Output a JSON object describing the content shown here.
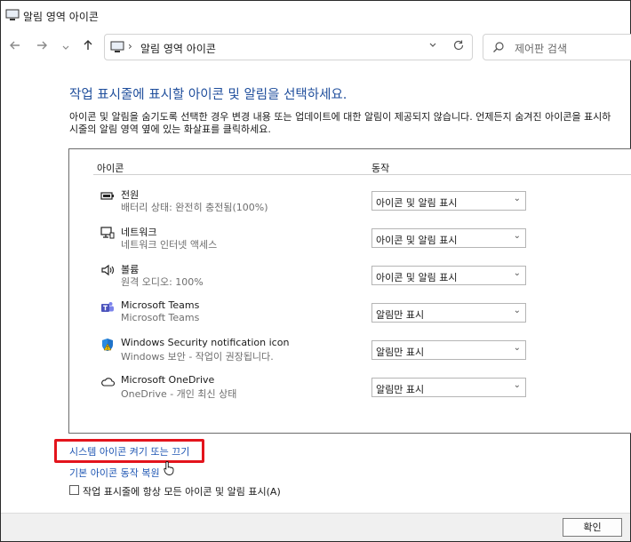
{
  "window": {
    "title": "알림 영역 아이콘"
  },
  "nav": {
    "back_icon": "arrow-left-icon",
    "forward_icon": "arrow-right-icon",
    "recent_icon": "chevron-down-icon",
    "up_icon": "arrow-up-icon",
    "address_sep": "›",
    "address_text": "알림 영역 아이콘",
    "search_placeholder": "제어판 검색"
  },
  "content": {
    "heading": "작업 표시줄에 표시할 아이콘 및 알림을 선택하세요.",
    "description_line1": "아이콘 및 알림을 숨기도록 선택한 경우 변경 내용 또는 업데이트에 대한 알림이 제공되지 않습니다. 언제든지 숨겨진 아이콘을 표시하",
    "description_line2": "시줄의 알림 영역 옆에 있는 화살표를 클릭하세요.",
    "col_icon": "아이콘",
    "col_action": "동작",
    "rows": [
      {
        "icon": "battery-icon",
        "name": "전원",
        "sub": "배터리 상태: 완전히 충전됨(100%)",
        "action": "아이콘 및 알림 표시"
      },
      {
        "icon": "network-icon",
        "name": "네트워크",
        "sub": "네트워크 인터넷 액세스",
        "action": "아이콘 및 알림 표시"
      },
      {
        "icon": "volume-icon",
        "name": "볼륨",
        "sub": "원격 오디오: 100%",
        "action": "아이콘 및 알림 표시"
      },
      {
        "icon": "teams-icon",
        "name": "Microsoft Teams",
        "sub": "Microsoft Teams",
        "action": "알림만 표시"
      },
      {
        "icon": "security-shield-icon",
        "name": "Windows Security notification icon",
        "sub": "Windows 보안 - 작업이 권장됩니다.",
        "action": "알림만 표시"
      },
      {
        "icon": "onedrive-cloud-icon",
        "name": "Microsoft OneDrive",
        "sub": "OneDrive - 개인 최신 상태",
        "action": "알림만 표시"
      }
    ],
    "link_system_icons": "시스템 아이콘 켜기 또는 끄기",
    "link_restore": "기본 아이콘 동작 복원",
    "checkbox_label": "작업 표시줄에 항상 모든 아이콘 및 알림 표시(A)",
    "checkbox_checked": false
  },
  "footer": {
    "ok_label": "확인"
  },
  "colors": {
    "heading": "#1f4e9c",
    "link": "#1f56b3",
    "highlight": "#e3141c"
  }
}
